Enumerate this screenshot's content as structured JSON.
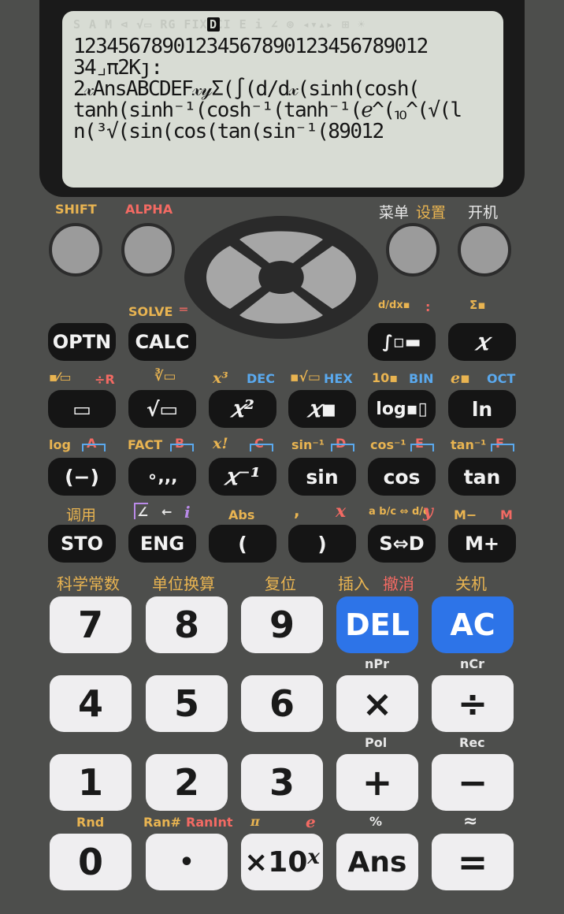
{
  "display": {
    "indicators": "S A M  ⊲  √▭  RG  FIXSCI  E  i  ∠  ⊚  ◂▾▴▸  ⊞  ☀",
    "angle_mode": "D",
    "lines": [
      "12345678901234567890123456789012",
      "34⌟π2Kȷ:",
      "2𝓍AnsABCDEF𝓍𝓎Σ(∫(d/d𝓍(sinh(cosh(",
      "tanh(sinh⁻¹(cosh⁻¹(tanh⁻¹(ℯ^(⏨^(√(l",
      "n(³√(sin(cos(tan(sin⁻¹(89012"
    ]
  },
  "top_labels": {
    "shift": "SHIFT",
    "alpha": "ALPHA",
    "menu": "菜单",
    "setup": "设置",
    "power_on": "开机"
  },
  "row1": {
    "solve": "SOLVE",
    "solve_eq": "═",
    "deriv_label": "d/dx▪",
    "colon": ":",
    "sum_label": "Σ▪",
    "optn": "OPTN",
    "calc": "CALC",
    "integral": "∫▫▬",
    "x_var": "𝑥"
  },
  "row2": {
    "labels": [
      "▪⁄▭",
      "÷R",
      "∛▭",
      "x³",
      "DEC",
      "▪√▭",
      "HEX",
      "10▪",
      "BIN",
      "e▪",
      "OCT"
    ],
    "keys": [
      "▭",
      "√▭",
      "𝑥²",
      "𝑥▪",
      "log▪▯",
      "ln"
    ]
  },
  "row3": {
    "labels": [
      "log",
      "A",
      "FACT",
      "B",
      "x!",
      "C",
      "sin⁻¹",
      "D",
      "cos⁻¹",
      "E",
      "tan⁻¹",
      "F"
    ],
    "keys": [
      "(−)",
      "∘,,,",
      "𝑥⁻¹",
      "sin",
      "cos",
      "tan"
    ]
  },
  "row4": {
    "labels": [
      "调用",
      "∠",
      "←",
      "i",
      "Abs",
      ",",
      "x",
      "a b/c ⇔ d/c",
      "y",
      "M−",
      "M"
    ],
    "keys": [
      "STO",
      "ENG",
      "(",
      ")",
      "S⇔D",
      "M+"
    ]
  },
  "num_labels": {
    "row1": [
      "科学常数",
      "单位换算",
      "复位",
      "插入",
      "撤消",
      "关机"
    ],
    "row2": [
      "nPr",
      "nCr"
    ],
    "row3": [
      "Pol",
      "Rec"
    ],
    "row4": [
      "Rnd",
      "Ran#",
      "RanInt",
      "π",
      "e",
      "%",
      "≈"
    ]
  },
  "num_keys": {
    "row1": [
      "7",
      "8",
      "9",
      "DEL",
      "AC"
    ],
    "row2": [
      "4",
      "5",
      "6",
      "×",
      "÷"
    ],
    "row3": [
      "1",
      "2",
      "3",
      "+",
      "−"
    ],
    "row4": [
      "0",
      "•",
      "×10",
      "Ans",
      "="
    ],
    "exp_sup": "x"
  },
  "colors": {
    "body": "#4d4e4c",
    "lcd": "#d8dcd4",
    "shift_yellow": "#e9b451",
    "alpha_red": "#f36a63",
    "base_blue": "#5aa9ee",
    "del_ac_blue": "#2d74e8"
  }
}
